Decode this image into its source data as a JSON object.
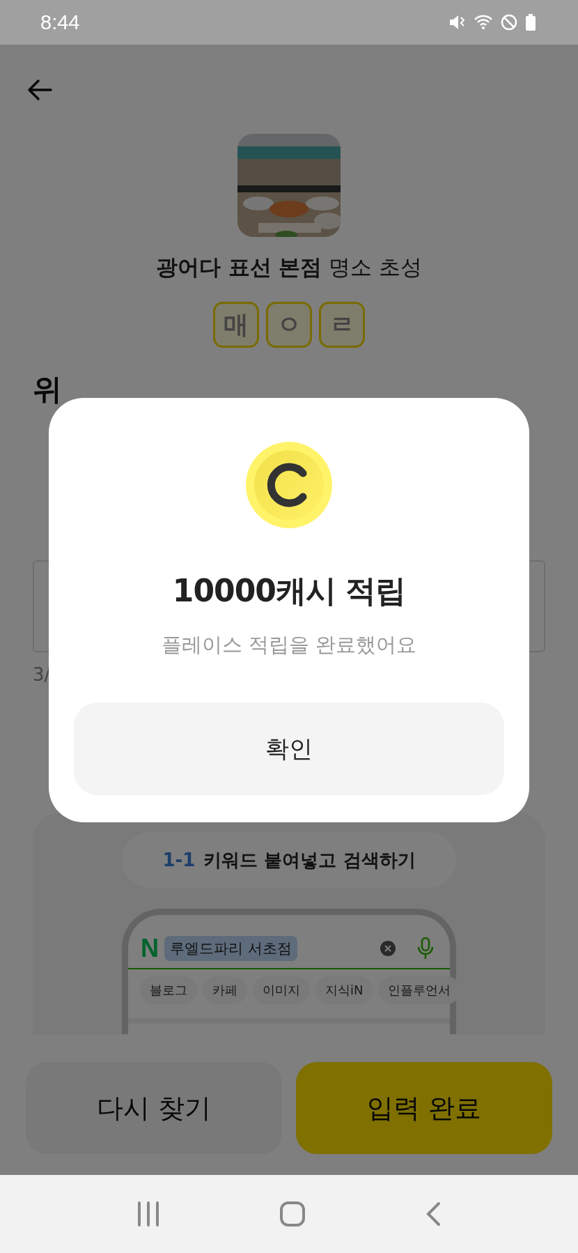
{
  "status_bar": {
    "time": "8:44"
  },
  "place": {
    "title": "**광어다 표선 본점** 명소 초성",
    "initials": [
      {
        "text": "매"
      },
      {
        "text": "ㅇ"
      },
      {
        "text": "ㄹ"
      }
    ]
  },
  "question": {
    "line_1": "위"
  },
  "input": {
    "counter": "3/"
  },
  "guide": {
    "step": "1-1",
    "title": "키워드 붙여넣고 검색하기",
    "search_logo": "N",
    "search_query": "루엘드파리 서초점",
    "search_tabs": [
      "블로그",
      "카페",
      "이미지",
      "지식iN",
      "인플루언서"
    ]
  },
  "buttons": [
    {
      "label": "다시 찾기",
      "kind": "secondary"
    },
    {
      "label": "입력 완료",
      "kind": "primary"
    }
  ],
  "dialog": {
    "title": "10000캐시 적립",
    "message": "플레이스 적립을 완료했어요",
    "confirm": "확인"
  }
}
